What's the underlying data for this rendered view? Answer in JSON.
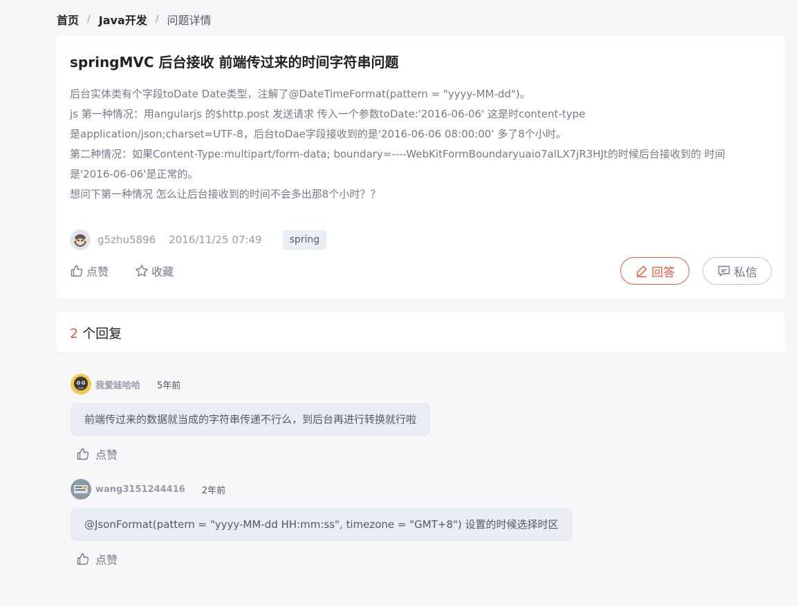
{
  "breadcrumb": {
    "home": "首页",
    "sep": "/",
    "category": "Java开发",
    "current": "问题详情"
  },
  "question": {
    "title": "springMVC 后台接收 前端传过来的时间字符串问题",
    "body": [
      "后台实体类有个字段toDate Date类型，注解了@DateTimeFormat(pattern = \"yyyy-MM-dd\")。",
      "js 第一种情况：用angularjs 的$http.post 发送请求 传入一个参数toDate:'2016-06-06' 这是时content-type",
      "是application/json;charset=UTF-8，后台toDae字段接收到的是'2016-06-06 08:00:00' 多了8个小时。",
      "第二种情况：如果Content-Type:multipart/form-data; boundary=----WebKitFormBoundaryuaio7alLX7jR3HJt的时候后台接收到的 时间",
      "是'2016-06-06'是正常的。",
      "想问下第一种情况 怎么让后台接收到的时间不会多出那8个小时？？"
    ],
    "author": "g5zhu5896",
    "time": "2016/11/25 07:49",
    "tag": "spring",
    "like_label": "点赞",
    "favorite_label": "收藏",
    "answer_label": "回答",
    "message_label": "私信"
  },
  "answers": {
    "count": "2",
    "count_suffix": "个回复",
    "items": [
      {
        "user": "我爱娃哈哈",
        "time": "5年前",
        "content": "前端传过来的数据就当成的字符串传递不行么，到后台再进行转换就行啦",
        "like_label": "点赞"
      },
      {
        "user": "wang3151244416",
        "time": "2年前",
        "content": "@JsonFormat(pattern = \"yyyy-MM-dd HH:mm:ss\", timezone = \"GMT+8\") 设置的时候选择时区",
        "like_label": "点赞"
      }
    ]
  },
  "colors": {
    "accent": "#e8593c",
    "tag_bg": "#eaeff7",
    "bubble_bg": "#eaecf5"
  },
  "icons": {
    "like": "thumbs-up-icon",
    "favorite": "star-icon",
    "answer": "pencil-icon",
    "message": "chat-bubble-icon"
  }
}
